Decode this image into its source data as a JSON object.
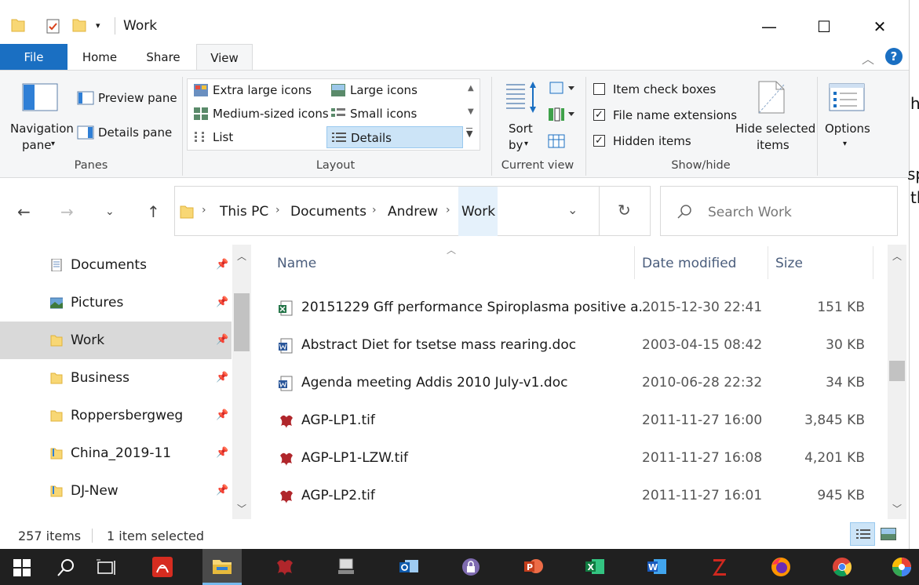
{
  "window": {
    "title": "Work",
    "minimize_glyph": "—",
    "maximize_glyph": "☐",
    "close_glyph": "✕"
  },
  "ribbon_tabs": [
    "File",
    "Home",
    "Share",
    "View"
  ],
  "ribbon": {
    "panes": {
      "navigation_pane_line1": "Navigation",
      "navigation_pane_line2": "pane",
      "preview_pane": "Preview pane",
      "details_pane": "Details pane",
      "group_label": "Panes"
    },
    "layout": {
      "items": [
        "Extra large icons",
        "Large icons",
        "Medium-sized icons",
        "Small icons",
        "List",
        "Details"
      ],
      "selected": "Details",
      "group_label": "Layout"
    },
    "current_view": {
      "sort_line1": "Sort",
      "sort_line2": "by",
      "group_label": "Current view"
    },
    "show_hide": {
      "item_check_boxes": {
        "label": "Item check boxes",
        "checked": false
      },
      "file_name_extensions": {
        "label": "File name extensions",
        "checked": true
      },
      "hidden_items": {
        "label": "Hidden items",
        "checked": true
      },
      "hide_selected_line1": "Hide selected",
      "hide_selected_line2": "items",
      "group_label": "Show/hide"
    },
    "options_label": "Options"
  },
  "address": {
    "crumbs": [
      "This PC",
      "Documents",
      "Andrew",
      "Work"
    ],
    "search_placeholder": "Search Work"
  },
  "nav_pane": [
    {
      "label": "Documents",
      "icon": "documents-icon",
      "selected": false
    },
    {
      "label": "Pictures",
      "icon": "pictures-icon",
      "selected": false
    },
    {
      "label": "Work",
      "icon": "folder-icon",
      "selected": true
    },
    {
      "label": "Business",
      "icon": "folder-icon",
      "selected": false
    },
    {
      "label": "Roppersbergweg",
      "icon": "folder-icon",
      "selected": false
    },
    {
      "label": "China_2019-11",
      "icon": "folder-icon",
      "selected": false
    },
    {
      "label": "DJ-New",
      "icon": "folder-icon",
      "selected": false
    }
  ],
  "file_list": {
    "columns": [
      "Name",
      "Date modified",
      "Size"
    ],
    "rows": [
      {
        "name": "20151229 Gff performance Spiroplasma positive a...",
        "date": "2015-12-30 22:41",
        "size": "151 KB",
        "icon": "excel-file-icon"
      },
      {
        "name": "Abstract Diet for tsetse mass rearing.doc",
        "date": "2003-04-15 08:42",
        "size": "30 KB",
        "icon": "word-file-icon"
      },
      {
        "name": "Agenda meeting Addis 2010 July-v1.doc",
        "date": "2010-06-28 22:32",
        "size": "34 KB",
        "icon": "word-file-icon"
      },
      {
        "name": "AGP-LP1.tif",
        "date": "2011-11-27 16:00",
        "size": "3,845 KB",
        "icon": "image-file-icon"
      },
      {
        "name": "AGP-LP1-LZW.tif",
        "date": "2011-11-27 16:08",
        "size": "4,201 KB",
        "icon": "image-file-icon"
      },
      {
        "name": "AGP-LP2.tif",
        "date": "2011-11-27 16:01",
        "size": "945 KB",
        "icon": "image-file-icon"
      }
    ]
  },
  "status": {
    "item_count": "257 items",
    "selection": "1 item selected"
  },
  "background_text": [
    "h",
    "sp",
    "th"
  ],
  "colors": {
    "accent": "#1a6fc2",
    "selection": "#cce4f7",
    "taskbar": "#202020"
  }
}
